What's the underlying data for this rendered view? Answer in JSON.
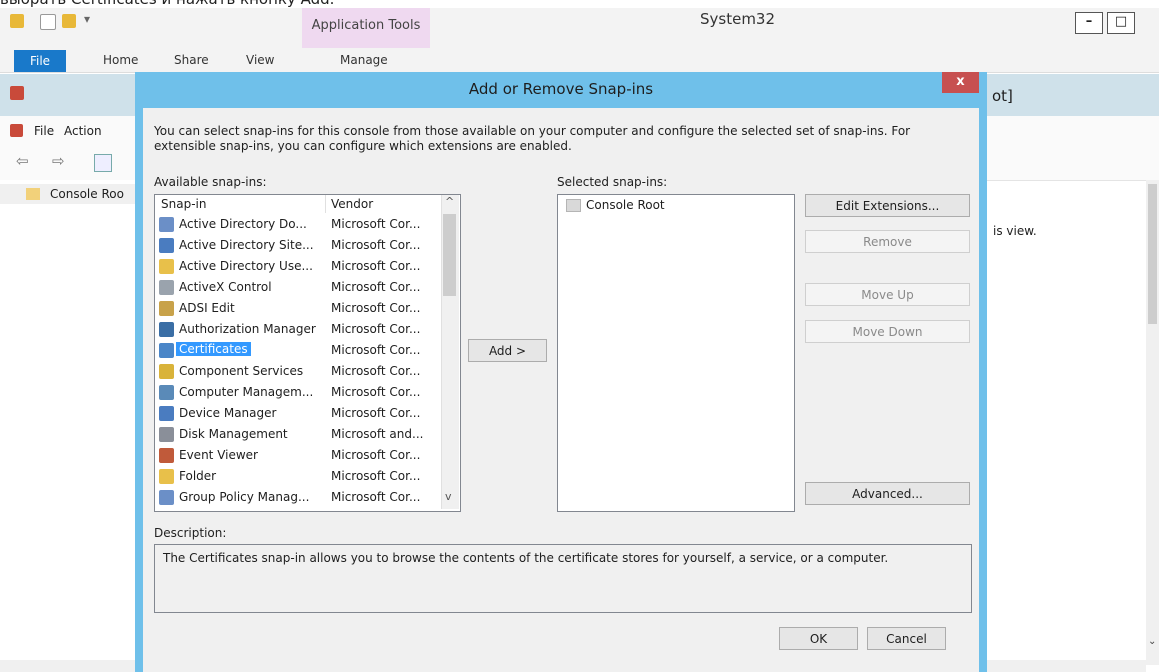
{
  "caption": "выбрать Certificates и нажать кнопку Add.",
  "explorer": {
    "app_tools": "Application Tools",
    "title": "System32",
    "tabs": {
      "file": "File",
      "home": "Home",
      "share": "Share",
      "view": "View",
      "manage": "Manage"
    },
    "min_btn": "–",
    "max_btn": "□"
  },
  "mmc": {
    "title_fragment": "ot]",
    "menu": {
      "file": "File",
      "action": "Action"
    },
    "tree_root": "Console Roo",
    "view_text": "is view."
  },
  "dialog": {
    "title": "Add or Remove Snap-ins",
    "close": "x",
    "intro_line1": "You can select snap-ins for this console from those available on your computer and configure the selected set of snap-ins. For",
    "intro_line2": "extensible snap-ins, you can configure which extensions are enabled.",
    "available_label": "Available snap-ins:",
    "selected_label": "Selected snap-ins:",
    "col_snapin": "Snap-in",
    "col_vendor": "Vendor",
    "snapins": [
      {
        "name": "Active Directory Do...",
        "vendor": "Microsoft Cor...",
        "icon": "directory-icon"
      },
      {
        "name": "Active Directory Site...",
        "vendor": "Microsoft Cor...",
        "icon": "sites-icon"
      },
      {
        "name": "Active Directory Use...",
        "vendor": "Microsoft Cor...",
        "icon": "users-icon"
      },
      {
        "name": "ActiveX Control",
        "vendor": "Microsoft Cor...",
        "icon": "activex-icon"
      },
      {
        "name": "ADSI Edit",
        "vendor": "Microsoft Cor...",
        "icon": "adsi-edit-icon"
      },
      {
        "name": "Authorization Manager",
        "vendor": "Microsoft Cor...",
        "icon": "authorization-icon"
      },
      {
        "name": "Certificates",
        "vendor": "Microsoft Cor...",
        "icon": "certificates-icon"
      },
      {
        "name": "Component Services",
        "vendor": "Microsoft Cor...",
        "icon": "component-services-icon"
      },
      {
        "name": "Computer Managem...",
        "vendor": "Microsoft Cor...",
        "icon": "computer-management-icon"
      },
      {
        "name": "Device Manager",
        "vendor": "Microsoft Cor...",
        "icon": "device-manager-icon"
      },
      {
        "name": "Disk Management",
        "vendor": "Microsoft and...",
        "icon": "disk-management-icon"
      },
      {
        "name": "Event Viewer",
        "vendor": "Microsoft Cor...",
        "icon": "event-viewer-icon"
      },
      {
        "name": "Folder",
        "vendor": "Microsoft Cor...",
        "icon": "folder-icon"
      },
      {
        "name": "Group Policy Manag...",
        "vendor": "Microsoft Cor...",
        "icon": "group-policy-icon"
      }
    ],
    "selected_index": 6,
    "selected_item": "Console Root",
    "add_button": "Add >",
    "edit_extensions": "Edit Extensions...",
    "remove": "Remove",
    "move_up": "Move Up",
    "move_down": "Move Down",
    "advanced": "Advanced...",
    "description_label": "Description:",
    "description": "The Certificates snap-in allows you to browse the contents of the certificate stores for yourself, a service, or a computer.",
    "ok": "OK",
    "cancel": "Cancel"
  },
  "colors": {
    "accent": "#1979ca",
    "dialog_frame": "#6fc0ea",
    "selection": "#3399ff",
    "close": "#c75050"
  }
}
